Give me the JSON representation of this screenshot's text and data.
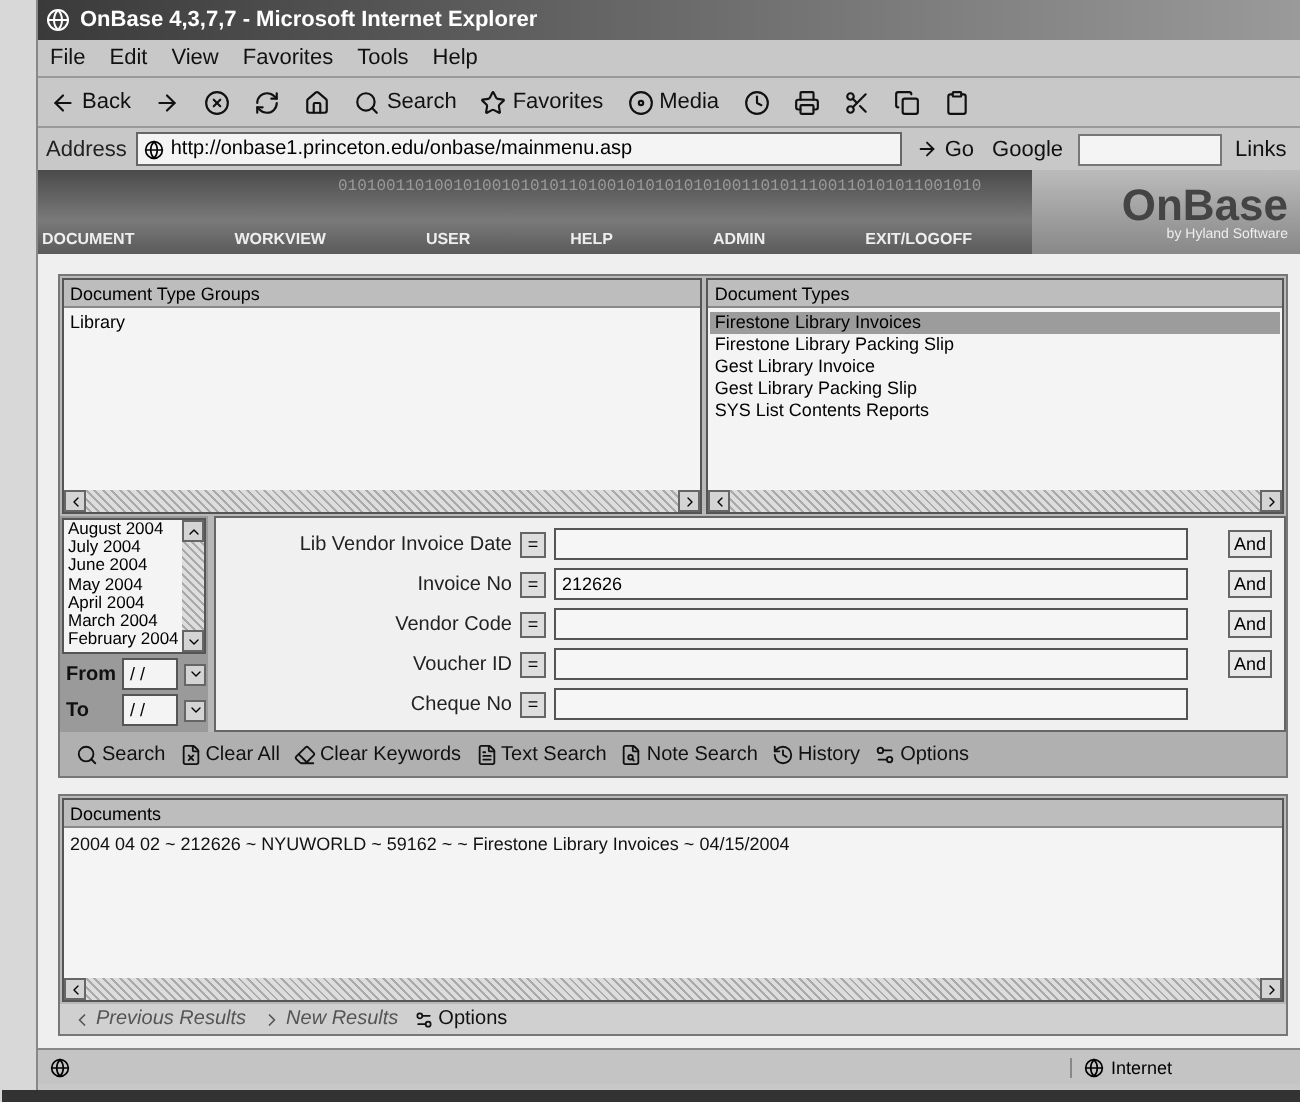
{
  "window": {
    "title": "OnBase 4,3,7,7 - Microsoft Internet Explorer"
  },
  "menu": [
    "File",
    "Edit",
    "View",
    "Favorites",
    "Tools",
    "Help"
  ],
  "toolbar": [
    {
      "kind": "back",
      "label": "Back"
    },
    {
      "kind": "forward"
    },
    {
      "kind": "stop"
    },
    {
      "kind": "refresh"
    },
    {
      "kind": "home"
    },
    {
      "kind": "search",
      "label": "Search"
    },
    {
      "kind": "favorites",
      "label": "Favorites"
    },
    {
      "kind": "media",
      "label": "Media"
    },
    {
      "kind": "history"
    },
    {
      "kind": "print"
    },
    {
      "kind": "cut"
    },
    {
      "kind": "copy"
    },
    {
      "kind": "paste"
    }
  ],
  "address": {
    "label": "Address",
    "url": "http://onbase1.princeton.edu/onbase/mainmenu.asp",
    "go": "Go",
    "search_brand": "Google",
    "links": "Links"
  },
  "banner": {
    "pattern": "0101001101001010010101011010010101010101001101011100110101011001010",
    "nav": [
      "DOCUMENT",
      "WORKVIEW",
      "USER",
      "HELP",
      "ADMIN",
      "EXIT/LOGOFF"
    ],
    "logo": "OnBase",
    "tagline": "by Hyland Software"
  },
  "groups": {
    "title": "Document Type Groups",
    "items": [
      {
        "label": "Library",
        "selected": false
      }
    ]
  },
  "types": {
    "title": "Document Types",
    "items": [
      {
        "label": "Firestone Library Invoices",
        "selected": true
      },
      {
        "label": "Firestone Library Packing Slip",
        "selected": false
      },
      {
        "label": "Gest Library Invoice",
        "selected": false
      },
      {
        "label": "Gest Library Packing Slip",
        "selected": false
      },
      {
        "label": "SYS List Contents Reports",
        "selected": false
      }
    ]
  },
  "dates": {
    "items": [
      "August 2004",
      "July 2004",
      "June 2004",
      "May 2004",
      "April 2004",
      "March 2004",
      "February 2004"
    ],
    "from": {
      "label": "From",
      "value": "/ /"
    },
    "to": {
      "label": "To",
      "value": "/ /"
    }
  },
  "keywords": [
    {
      "label": "Lib Vendor Invoice Date",
      "operator": "=",
      "conjunction": "And"
    },
    {
      "label": "Invoice No",
      "operator": "=",
      "value": "212626",
      "conjunction": "And"
    },
    {
      "label": "Vendor Code",
      "operator": "=",
      "conjunction": "And"
    },
    {
      "label": "Voucher ID",
      "operator": "=",
      "conjunction": "And"
    },
    {
      "label": "Cheque No",
      "operator": "="
    }
  ],
  "actions": [
    {
      "kind": "search",
      "label": "Search"
    },
    {
      "kind": "clear",
      "label": "Clear All"
    },
    {
      "kind": "clearkw",
      "label": "Clear Keywords"
    },
    {
      "kind": "text",
      "label": "Text Search"
    },
    {
      "kind": "note",
      "label": "Note Search"
    },
    {
      "kind": "history",
      "label": "History"
    },
    {
      "kind": "options",
      "label": "Options"
    }
  ],
  "documents": {
    "title": "Documents",
    "rows": [
      "2004 04 02 ~ 212626 ~ NYUWORLD ~ 59162 ~  ~ Firestone Library Invoices ~ 04/15/2004"
    ]
  },
  "result_actions": [
    {
      "kind": "prev",
      "label": "Previous Results",
      "disabled": true
    },
    {
      "kind": "next",
      "label": "New Results",
      "disabled": true
    },
    {
      "kind": "options",
      "label": "Options",
      "disabled": false
    }
  ],
  "status": {
    "zone": "Internet"
  }
}
